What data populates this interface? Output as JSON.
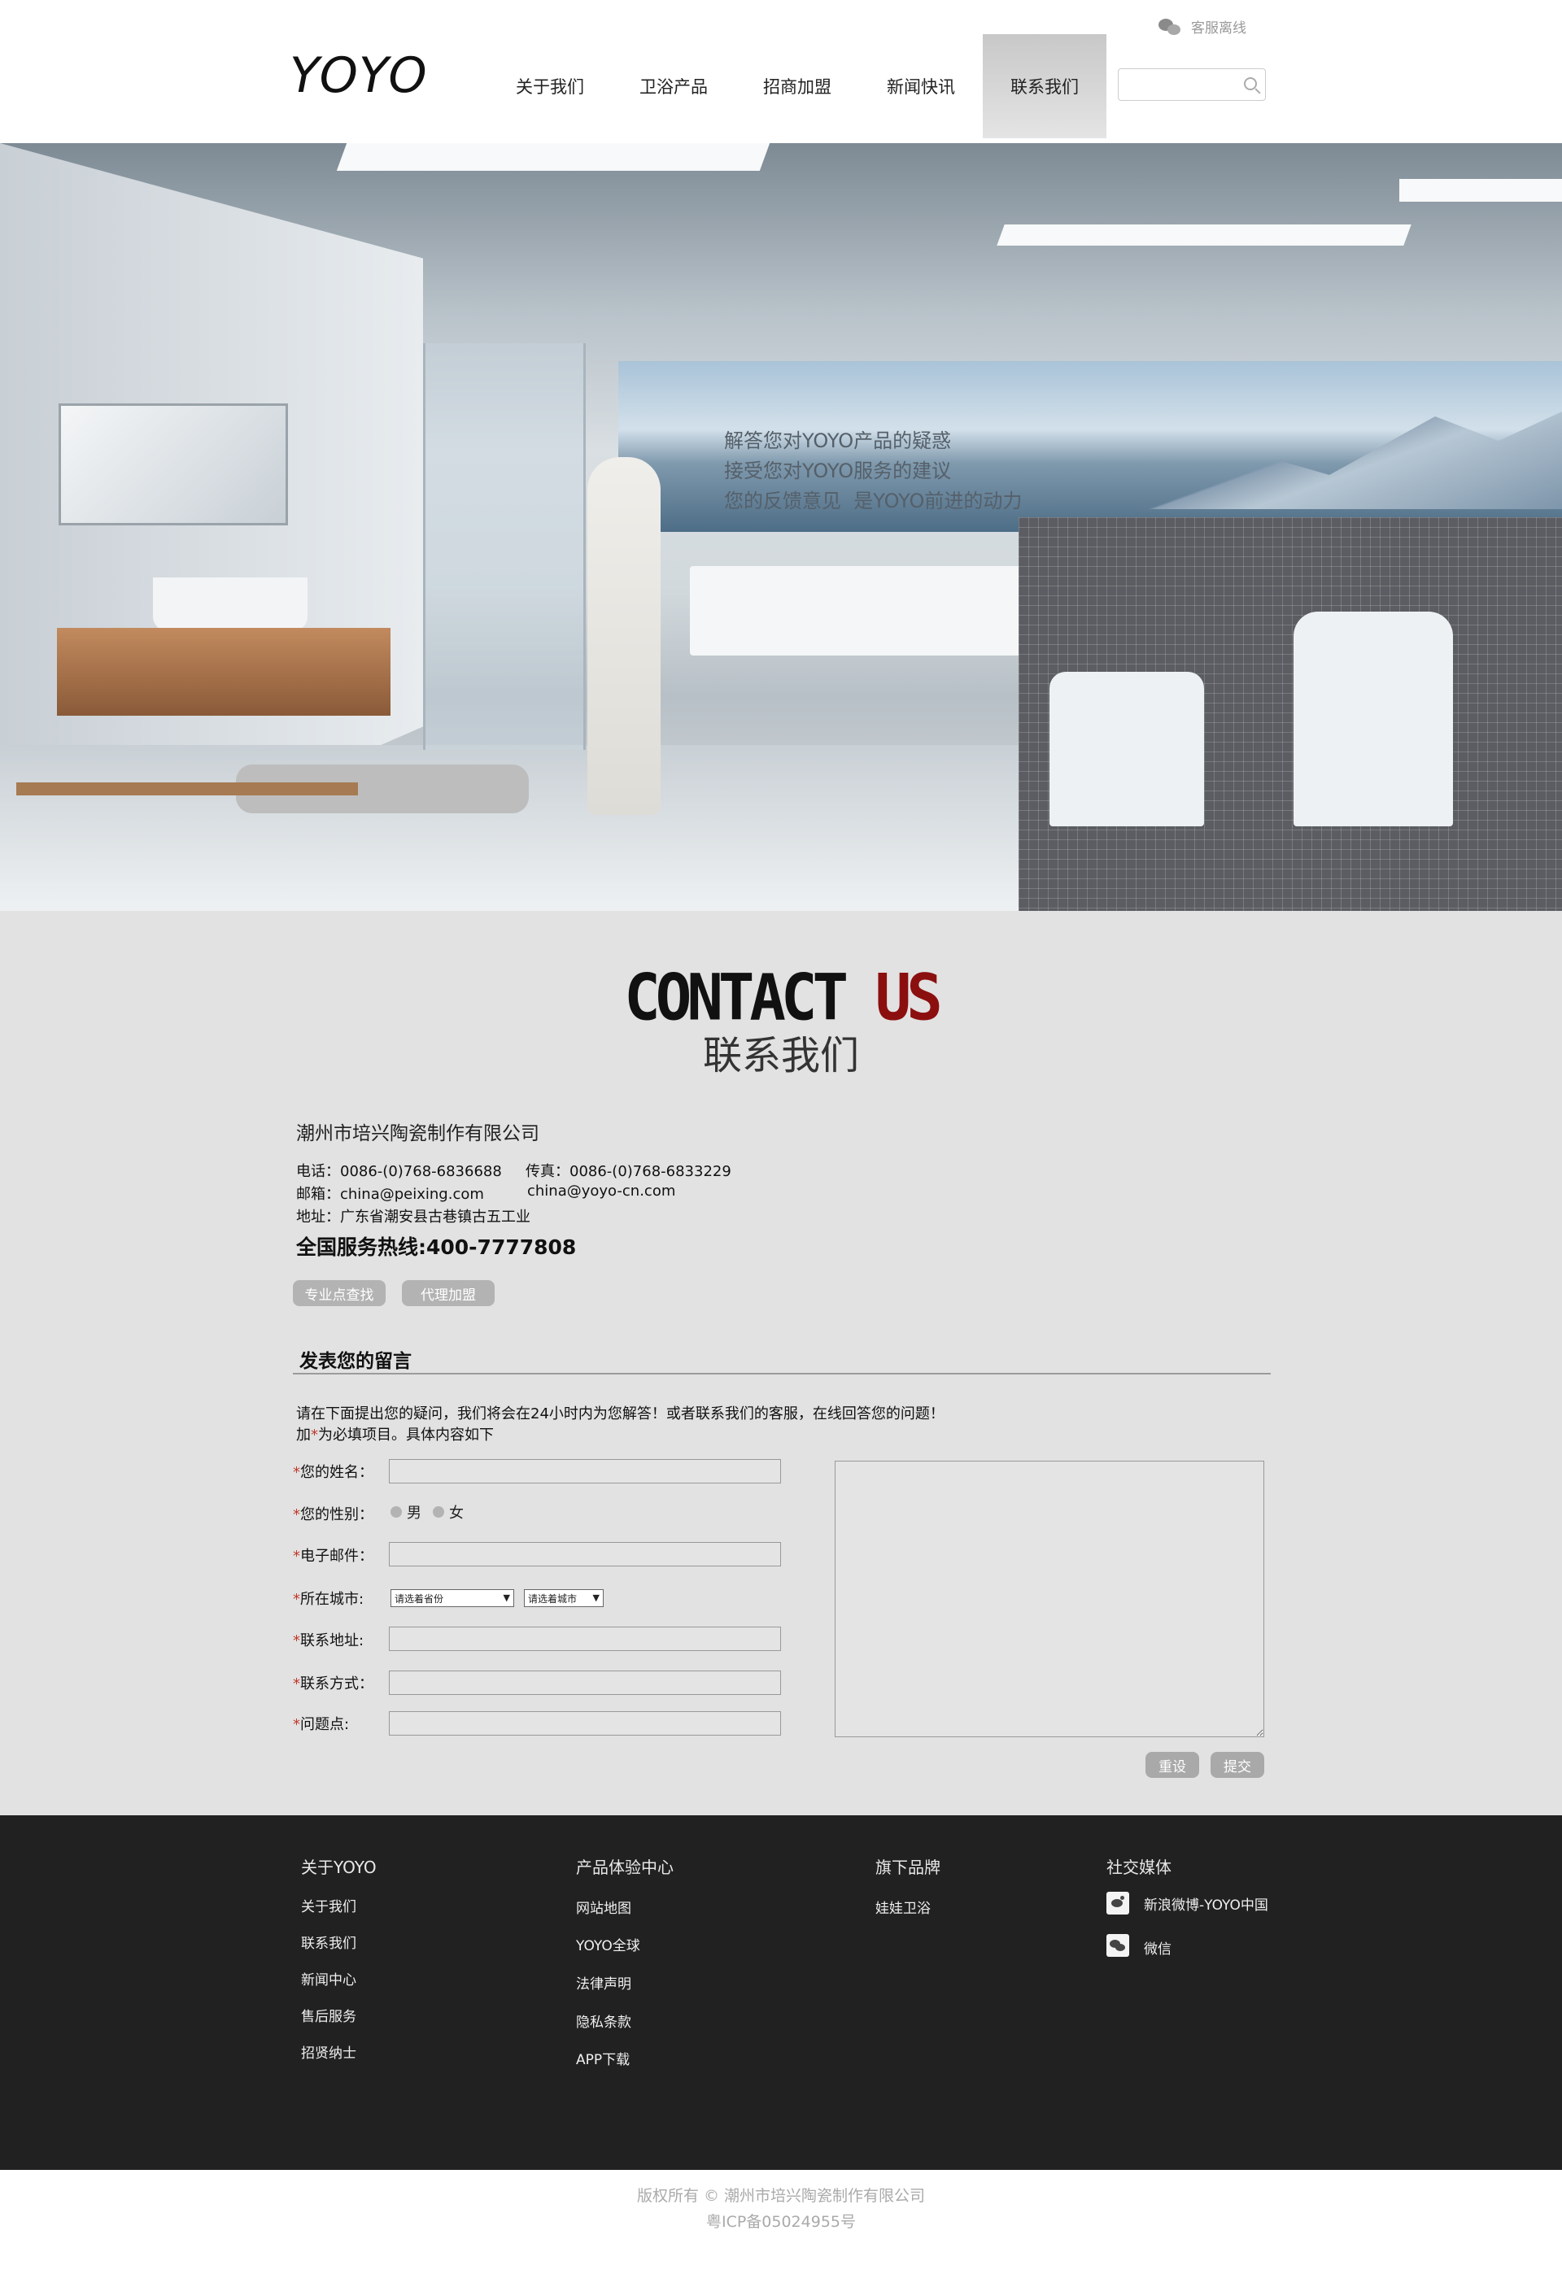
{
  "header": {
    "logo": "YOYO",
    "service_label": "客服离线",
    "nav": [
      "关于我们",
      "卫浴产品",
      "招商加盟",
      "新闻快讯",
      "联系我们"
    ],
    "active_nav": "联系我们",
    "search_placeholder": ""
  },
  "hero": {
    "lines": [
      "解答您对YOYO产品的疑惑",
      "接受您对YOYO服务的建议",
      "您的反馈意见  是YOYO前进的动力"
    ]
  },
  "contact": {
    "title_black": "CONTACT",
    "title_red": "US",
    "subtitle": "联系我们",
    "company": "潮州市培兴陶瓷制作有限公司",
    "phone": "电话：0086-(0)768-6836688",
    "fax": "传真：0086-(0)768-6833229",
    "email1": "邮箱：china@peixing.com",
    "email2": "china@yoyo-cn.com",
    "address": "地址：广东省潮安县古巷镇古五工业",
    "hotline": "全国服务热线:400-7777808",
    "btn_find": "专业点查找",
    "btn_agent": "代理加盟"
  },
  "message": {
    "title": "发表您的留言",
    "intro1": "请在下面提出您的疑问，我们将会在24小时内为您解答！或者联系我们的客服，在线回答您的问题！",
    "intro2_a": "加",
    "intro2_star": "*",
    "intro2_b": "为必填项目。具体内容如下",
    "required_mark": "*",
    "labels": [
      "您的姓名：",
      "您的性别：",
      "电子邮件：",
      "所在城市:",
      "联系地址:",
      "联系方式：",
      "问题点:"
    ],
    "gender_male": "男",
    "gender_female": "女",
    "province_placeholder": "请选着省份",
    "city_placeholder": "请选着城市",
    "reset": "重设",
    "submit": "提交"
  },
  "footer": {
    "col1_head": "关于YOYO",
    "col1": [
      "关于我们",
      "联系我们",
      "新闻中心",
      "售后服务",
      "招贤纳士"
    ],
    "col2_head": "产品体验中心",
    "col2": [
      "网站地图",
      "YOYO全球",
      "法律声明",
      "隐私条款",
      "APP下载"
    ],
    "col3_head": "旗下品牌",
    "col3": [
      "娃娃卫浴"
    ],
    "col4_head": "社交媒体",
    "weibo": "新浪微博-YOYO中国",
    "wechat": "微信"
  },
  "copyright": {
    "line1": "版权所有 © 潮州市培兴陶瓷制作有限公司",
    "line2": "粤ICP备05024955号"
  },
  "colors": {
    "accent_red": "#8c0f0f",
    "section_gray": "#e2e2e2",
    "footer_bg": "#212121"
  }
}
